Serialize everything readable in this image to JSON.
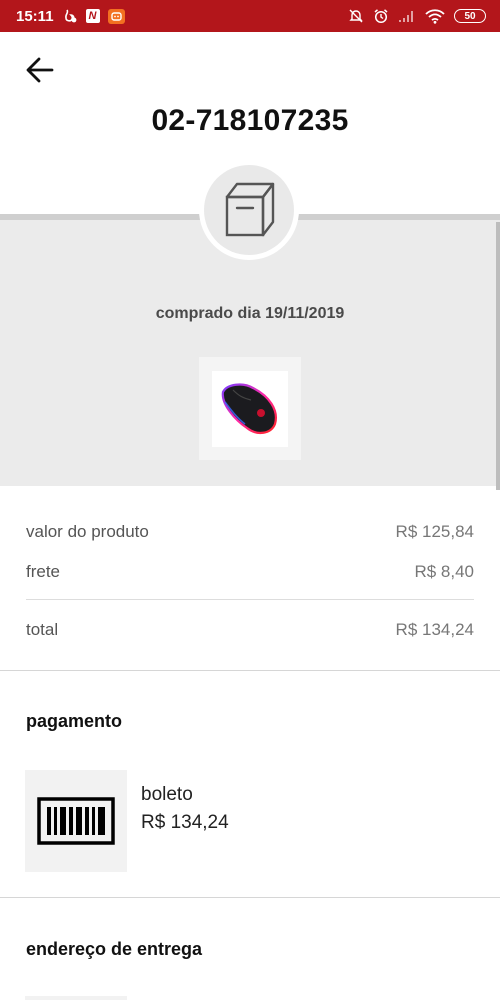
{
  "status_bar": {
    "time": "15:11",
    "nu_badge": "N",
    "battery": "50",
    "icons": [
      "fire-icon",
      "app-icon",
      "mute-icon",
      "alarm-icon",
      "signal-icon",
      "wifi-icon",
      "battery-icon"
    ]
  },
  "header": {
    "back_icon": "arrow-left-icon",
    "order_id": "02-718107235"
  },
  "hero": {
    "status_icon": "box-icon",
    "purchase_date": "comprado dia 19/11/2019",
    "product_image": "gaming-mouse-image"
  },
  "summary": {
    "product_label": "valor do produto",
    "product_value": "R$ 125,84",
    "shipping_label": "frete",
    "shipping_value": "R$ 8,40",
    "total_label": "total",
    "total_value": "R$ 134,24"
  },
  "payment": {
    "title": "pagamento",
    "icon": "barcode-icon",
    "method": "boleto",
    "amount": "R$ 134,24"
  },
  "delivery": {
    "title": "endereço de entrega"
  },
  "colors": {
    "status_bar": "#b3161b",
    "hero_background": "#ebebeb",
    "divider": "#dddddd"
  }
}
